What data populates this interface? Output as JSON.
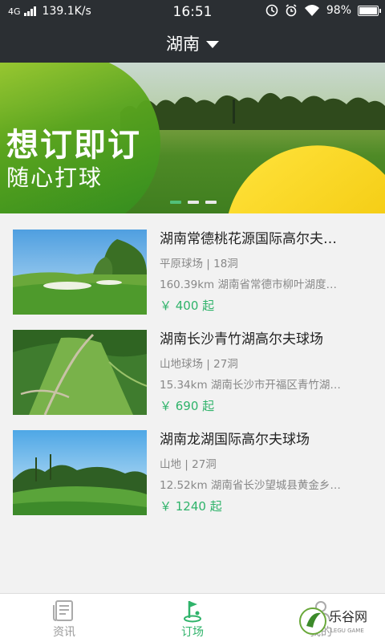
{
  "status_bar": {
    "network": "4G",
    "speed": "139.1K/s",
    "time": "16:51",
    "battery": "98%",
    "battery_level": 0.98
  },
  "header": {
    "title": "湖南"
  },
  "banner": {
    "headline": "想订即订",
    "tagline": "随心打球",
    "slide_count": 3,
    "active_slide": 1
  },
  "courses": [
    {
      "name": "湖南常德桃花源国际高尔夫…",
      "meta": "平原球场 | 18洞",
      "address": "160.39km  湖南省常德市柳叶湖度…",
      "price": "￥ 400 起"
    },
    {
      "name": "湖南长沙青竹湖高尔夫球场",
      "meta": "山地球场 | 27洞",
      "address": "15.34km  湖南长沙市开福区青竹湖…",
      "price": "￥ 690 起"
    },
    {
      "name": "湖南龙湖国际高尔夫球场",
      "meta": "山地 | 27洞",
      "address": "12.52km  湖南省长沙望城县黄金乡…",
      "price": "￥ 1240 起"
    }
  ],
  "tabs": [
    {
      "label": "资讯",
      "icon": "news-icon",
      "active": false
    },
    {
      "label": "订场",
      "icon": "golf-flag-icon",
      "active": true
    },
    {
      "label": "我的",
      "icon": "profile-icon",
      "active": false
    }
  ],
  "watermark": {
    "text": "乐谷网",
    "sub": "LEGU GAME"
  },
  "colors": {
    "accent": "#2fb36a",
    "header_bg": "#2b2f33",
    "banner_green": "#5aa51e",
    "banner_yellow": "#f2c80c"
  }
}
